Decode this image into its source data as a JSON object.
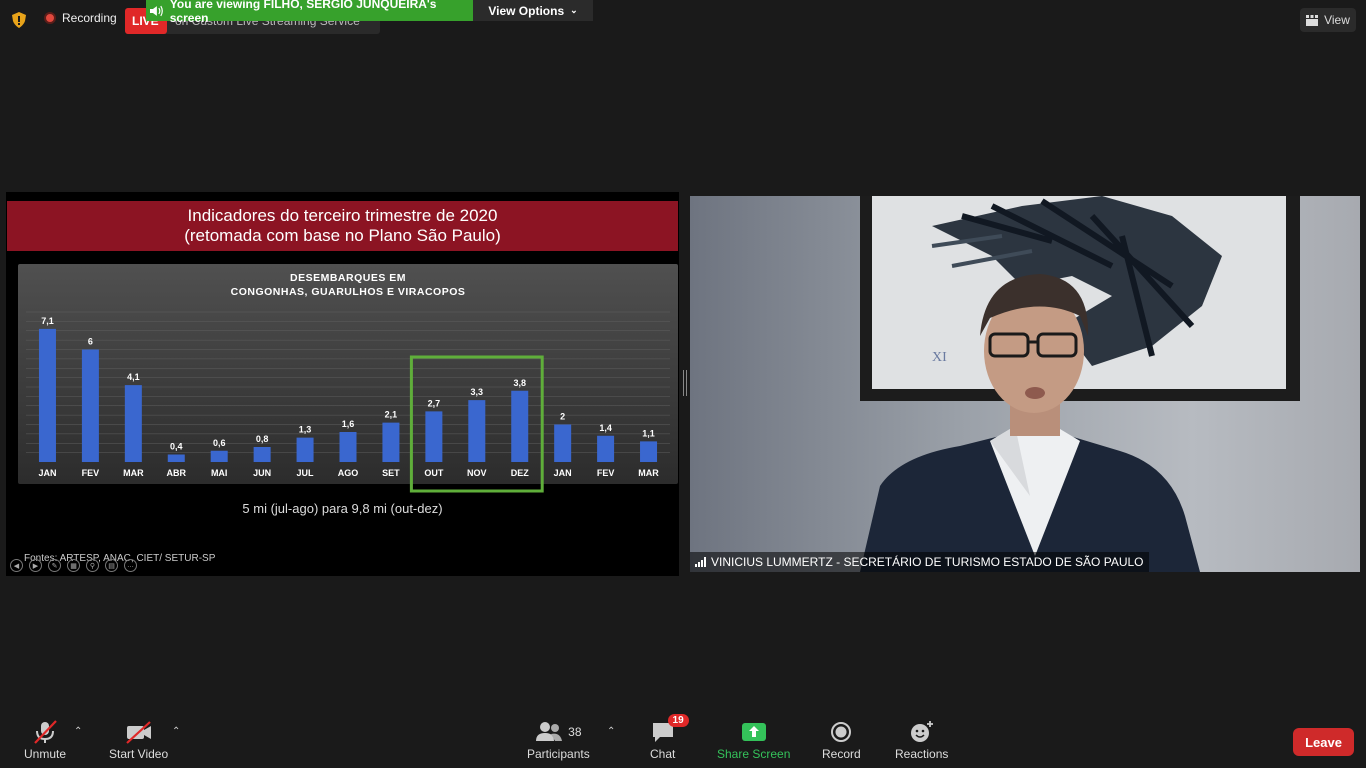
{
  "topbar": {
    "recording_label": "Recording",
    "live_label": "LIVE",
    "live_service": "on Custom Live Streaming Service",
    "viewing_banner": "You are viewing FILHO, SERGIO JUNQUEIRA's screen",
    "view_options_label": "View Options",
    "view_label": "View"
  },
  "slide": {
    "title_line1": "Indicadores do terceiro trimestre de 2020",
    "title_line2": "(retomada com base no Plano São Paulo)",
    "caption": "5 mi (jul-ago) para 9,8 mi (out-dez)",
    "source": "Fontes: ARTESP, ANAC, CIET/ SETUR-SP"
  },
  "chart_data": {
    "type": "bar",
    "title": "DESEMBARQUES EM\nCONGONHAS, GUARULHOS E VIRACOPOS",
    "title_line1": "DESEMBARQUES EM",
    "title_line2": "CONGONHAS, GUARULHOS E VIRACOPOS",
    "categories": [
      "JAN",
      "FEV",
      "MAR",
      "ABR",
      "MAI",
      "JUN",
      "JUL",
      "AGO",
      "SET",
      "OUT",
      "NOV",
      "DEZ",
      "JAN",
      "FEV",
      "MAR"
    ],
    "values": [
      7.1,
      6,
      4.1,
      0.4,
      0.6,
      0.8,
      1.3,
      1.6,
      2.1,
      2.7,
      3.3,
      3.8,
      2,
      1.4,
      1.1
    ],
    "data_labels": [
      "7,1",
      "6",
      "4,1",
      "0,4",
      "0,6",
      "0,8",
      "1,3",
      "1,6",
      "2,1",
      "2,7",
      "3,3",
      "3,8",
      "2",
      "1,4",
      "1,1"
    ],
    "highlighted_categories": [
      "OUT",
      "NOV",
      "DEZ"
    ],
    "highlight_color": "#5fae3a",
    "bar_color": "#3a67cf",
    "ylim": [
      0,
      8
    ],
    "grid": true,
    "xlabel": "",
    "ylabel": ""
  },
  "video": {
    "participant_name": "VINICIUS LUMMERTZ - SECRETÁRIO DE TURISMO ESTADO DE SÃO PAULO"
  },
  "toolbar": {
    "unmute_label": "Unmute",
    "start_video_label": "Start Video",
    "participants_label": "Participants",
    "participants_count": "38",
    "chat_label": "Chat",
    "chat_badge": "19",
    "share_screen_label": "Share Screen",
    "record_label": "Record",
    "reactions_label": "Reactions",
    "leave_label": "Leave"
  },
  "colors": {
    "live_red": "#e02828",
    "banner_green": "#37a12c",
    "share_green": "#34c25a",
    "leave_red": "#cf2a2a",
    "slide_title_bg": "#8c1423"
  }
}
